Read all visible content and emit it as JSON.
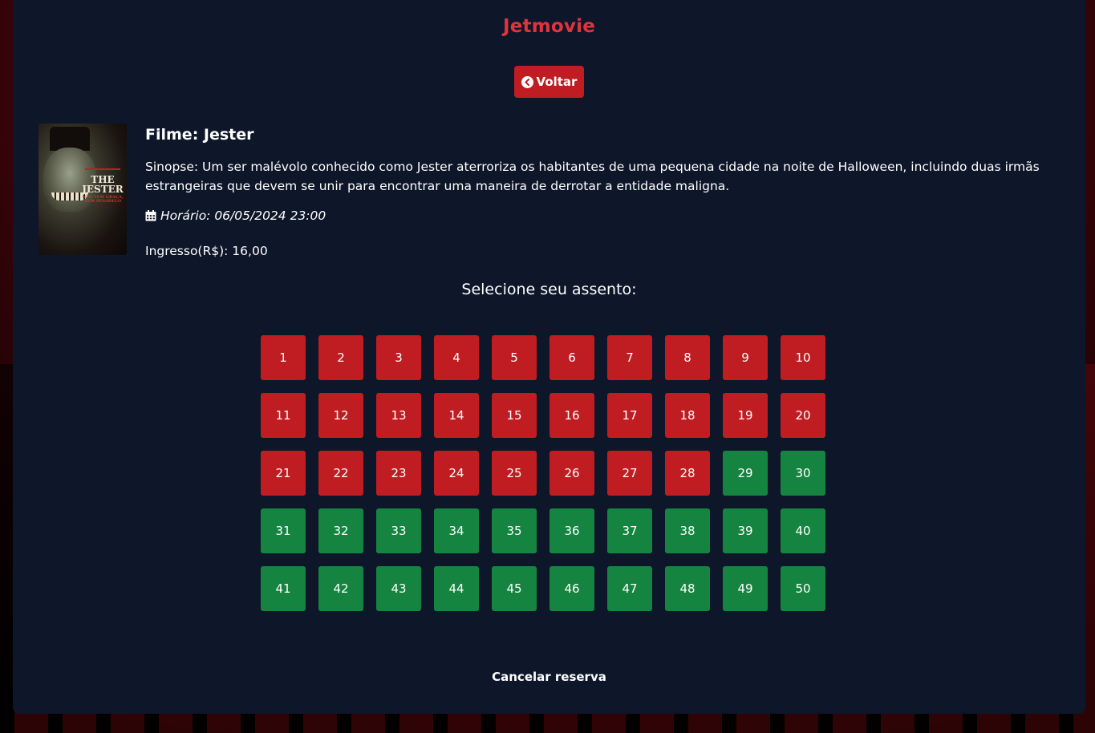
{
  "app": {
    "brand": "Jetmovie"
  },
  "nav": {
    "back_label": "Voltar",
    "back_icon": "chevron-left-circle-icon"
  },
  "movie": {
    "title": "Filme: Jester",
    "synopsis": "Sinopse: Um ser malévolo conhecido como Jester aterroriza os habitantes de uma pequena cidade na noite de Halloween, incluindo duas irmãs estrangeiras que devem se unir para encontrar uma maneira de derrotar a entidade maligna.",
    "schedule": "Horário: 06/05/2024 23:00",
    "schedule_icon": "calendar-icon",
    "price": "Ingresso(R$): 16,00",
    "poster": {
      "title_text": "THE JESTER",
      "tagline": "NÃO TEM GRAÇA, TEM PESADELO"
    }
  },
  "seating": {
    "heading": "Selecione seu assento:",
    "occupied_color": "#c01d22",
    "free_color": "#158440",
    "seats": [
      {
        "number": "1",
        "status": "occupied"
      },
      {
        "number": "2",
        "status": "occupied"
      },
      {
        "number": "3",
        "status": "occupied"
      },
      {
        "number": "4",
        "status": "occupied"
      },
      {
        "number": "5",
        "status": "occupied"
      },
      {
        "number": "6",
        "status": "occupied"
      },
      {
        "number": "7",
        "status": "occupied"
      },
      {
        "number": "8",
        "status": "occupied"
      },
      {
        "number": "9",
        "status": "occupied"
      },
      {
        "number": "10",
        "status": "occupied"
      },
      {
        "number": "11",
        "status": "occupied"
      },
      {
        "number": "12",
        "status": "occupied"
      },
      {
        "number": "13",
        "status": "occupied"
      },
      {
        "number": "14",
        "status": "occupied"
      },
      {
        "number": "15",
        "status": "occupied"
      },
      {
        "number": "16",
        "status": "occupied"
      },
      {
        "number": "17",
        "status": "occupied"
      },
      {
        "number": "18",
        "status": "occupied"
      },
      {
        "number": "19",
        "status": "occupied"
      },
      {
        "number": "20",
        "status": "occupied"
      },
      {
        "number": "21",
        "status": "occupied"
      },
      {
        "number": "22",
        "status": "occupied"
      },
      {
        "number": "23",
        "status": "occupied"
      },
      {
        "number": "24",
        "status": "occupied"
      },
      {
        "number": "25",
        "status": "occupied"
      },
      {
        "number": "26",
        "status": "occupied"
      },
      {
        "number": "27",
        "status": "occupied"
      },
      {
        "number": "28",
        "status": "occupied"
      },
      {
        "number": "29",
        "status": "free"
      },
      {
        "number": "30",
        "status": "free"
      },
      {
        "number": "31",
        "status": "free"
      },
      {
        "number": "32",
        "status": "free"
      },
      {
        "number": "33",
        "status": "free"
      },
      {
        "number": "34",
        "status": "free"
      },
      {
        "number": "35",
        "status": "free"
      },
      {
        "number": "36",
        "status": "free"
      },
      {
        "number": "37",
        "status": "free"
      },
      {
        "number": "38",
        "status": "free"
      },
      {
        "number": "39",
        "status": "free"
      },
      {
        "number": "40",
        "status": "free"
      },
      {
        "number": "41",
        "status": "free"
      },
      {
        "number": "42",
        "status": "free"
      },
      {
        "number": "43",
        "status": "free"
      },
      {
        "number": "44",
        "status": "free"
      },
      {
        "number": "45",
        "status": "free"
      },
      {
        "number": "46",
        "status": "free"
      },
      {
        "number": "47",
        "status": "free"
      },
      {
        "number": "48",
        "status": "free"
      },
      {
        "number": "49",
        "status": "free"
      },
      {
        "number": "50",
        "status": "free"
      }
    ]
  },
  "actions": {
    "cancel_label": "Cancelar reserva"
  }
}
